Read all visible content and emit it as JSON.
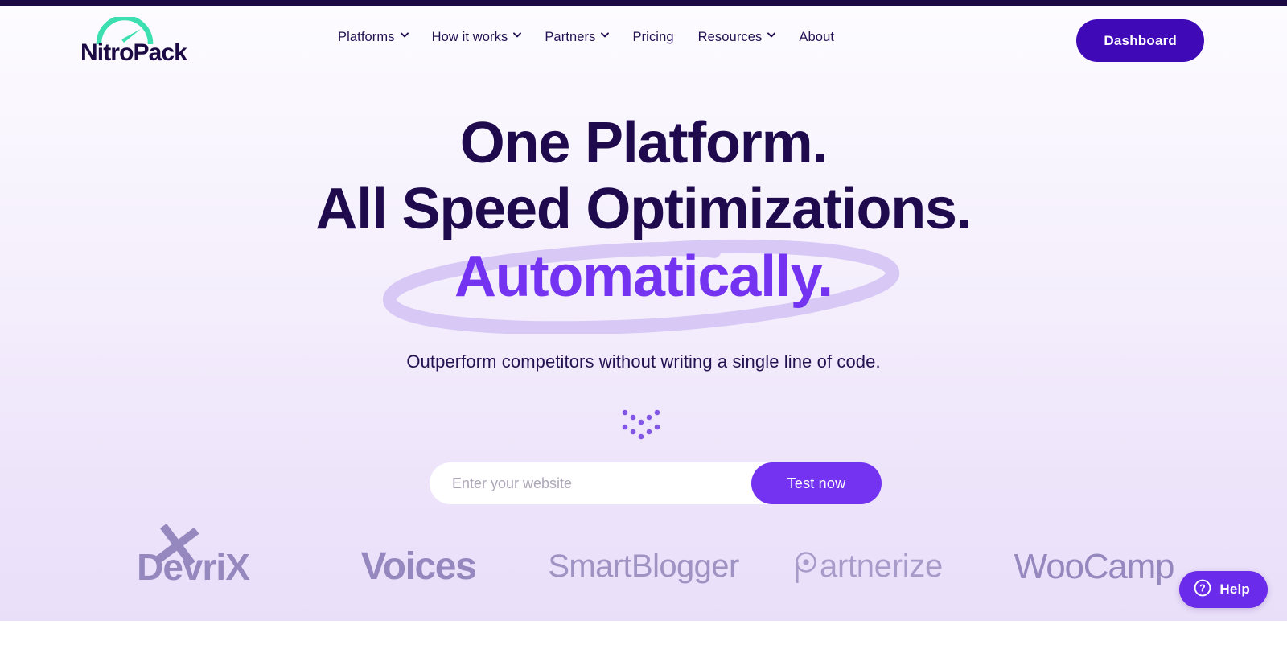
{
  "site": {
    "brand_name": "NitroPack",
    "logo_icon": "speedometer-icon",
    "accent_purple": "#7433F0",
    "deep_purple": "#4009B8",
    "navy": "#1F0A4E",
    "teal": "#3CE0B0"
  },
  "header": {
    "nav_items": [
      {
        "label": "Platforms",
        "has_dropdown": true,
        "caret_icon": "chevron-down-icon"
      },
      {
        "label": "How it works",
        "has_dropdown": true,
        "caret_icon": "chevron-down-icon"
      },
      {
        "label": "Partners",
        "has_dropdown": true,
        "caret_icon": "chevron-down-icon"
      },
      {
        "label": "Pricing",
        "has_dropdown": false
      },
      {
        "label": "Resources",
        "has_dropdown": true,
        "caret_icon": "chevron-down-icon"
      },
      {
        "label": "About",
        "has_dropdown": false
      }
    ],
    "dashboard_label": "Dashboard"
  },
  "hero": {
    "headline_line1": "One Platform.",
    "headline_line2": "All Speed Optimizations.",
    "headline_highlight": "Automatically.",
    "highlight_annotation": "hand-drawn-ellipse",
    "subtitle": "Outperform competitors without writing a single line of code.",
    "scroll_hint_icon": "double-chevron-down-dots"
  },
  "form": {
    "input_placeholder": "Enter your website",
    "input_value": "",
    "submit_label": "Test now"
  },
  "logos": {
    "heading": "",
    "items": [
      {
        "name": "DevriX",
        "mark": "x-mark"
      },
      {
        "name": "Voices"
      },
      {
        "name": "SmartBlogger"
      },
      {
        "name": "Partnerize",
        "mark": "p-dot-mark"
      },
      {
        "name": "WooCamp"
      }
    ]
  },
  "help_widget": {
    "label": "Help",
    "icon": "question-circle-icon"
  }
}
